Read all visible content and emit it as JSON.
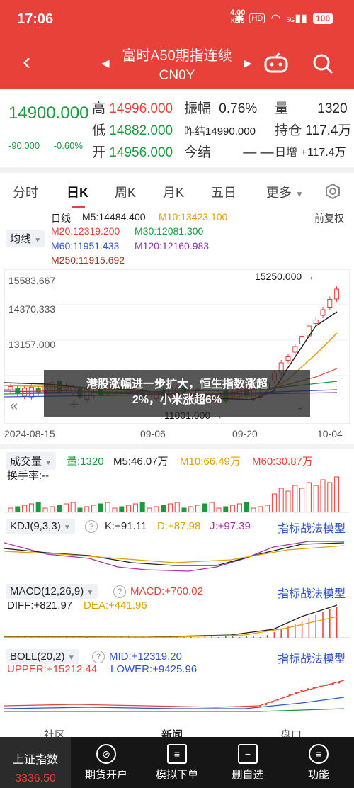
{
  "status": {
    "time": "17:06",
    "speed_value": "4.00",
    "speed_unit": "KB/S",
    "hd": "HD",
    "net": "5G",
    "battery": "100"
  },
  "header": {
    "title": "富时A50期指连续",
    "code": "CN0Y"
  },
  "quote": {
    "price": "14900.000",
    "change": "-90.000",
    "change_pct": "-0.60%",
    "high_label": "高",
    "high": "14996.000",
    "low_label": "低",
    "low": "14882.000",
    "open_label": "开",
    "open": "14956.000",
    "amp_label": "振幅",
    "amp": "0.76%",
    "settle_prev_label": "昨结",
    "settle_prev": "14990.000",
    "settle_label": "今结",
    "settle": "— —",
    "vol_label": "量",
    "vol": "1320",
    "oi_label": "持仓",
    "oi": "117.4万",
    "oi_inc_label": "日增",
    "oi_inc": "+117.4万"
  },
  "tabs": [
    "分时",
    "日K",
    "周K",
    "月K",
    "五日",
    "更多"
  ],
  "ma": {
    "line_label": "日线",
    "select": "均线",
    "m5": "M5:14484.400",
    "m10": "M10:13423.100",
    "restore": "前复权",
    "m20": "M20:12319.200",
    "m30": "M30:12081.300",
    "m60": "M60:11951.433",
    "m120": "M120:12160.983",
    "m250": "M250:11915.692"
  },
  "axis": {
    "y_top": "15583.667",
    "y_mid": "14370.333",
    "y_low": "13157.000",
    "hi_mark": "15250.000",
    "lo_mark": "11001.000",
    "dates": [
      "2024-08-15",
      "09-06",
      "09-20",
      "10-04"
    ]
  },
  "volume": {
    "select": "成交量",
    "vol": "量:1320",
    "m5": "M5:46.07万",
    "m10": "M10:66.49万",
    "m60": "M60:30.87万",
    "turnover": "换手率:--"
  },
  "kdj": {
    "select": "KDJ(9,3,3)",
    "k": "K:+91.11",
    "d": "D:+87.98",
    "j": "J:+97.39",
    "strategy": "指标战法模型"
  },
  "macd": {
    "select": "MACD(12,26,9)",
    "macd": "MACD:+760.02",
    "diff": "DIFF:+821.97",
    "dea": "DEA:+441.96",
    "strategy": "指标战法模型"
  },
  "boll": {
    "select": "BOLL(20,2)",
    "mid": "MID:+12319.20",
    "upper": "UPPER:+15212.44",
    "lower": "LOWER:+9425.96",
    "strategy": "指标战法模型"
  },
  "toast": {
    "line1": "港股涨幅进一步扩大，恒生指数涨超",
    "line2": "2%，小米涨超6%"
  },
  "behind_tabs": [
    "社区",
    "新闻",
    "盘口"
  ],
  "nav": {
    "index_name": "上证指数",
    "index_value": "3336.50",
    "items": [
      "期货开户",
      "模拟下单",
      "删自选",
      "功能"
    ]
  },
  "colors": {
    "red": "#e8413a",
    "green": "#1a9a3d",
    "blue": "#3355cc"
  }
}
